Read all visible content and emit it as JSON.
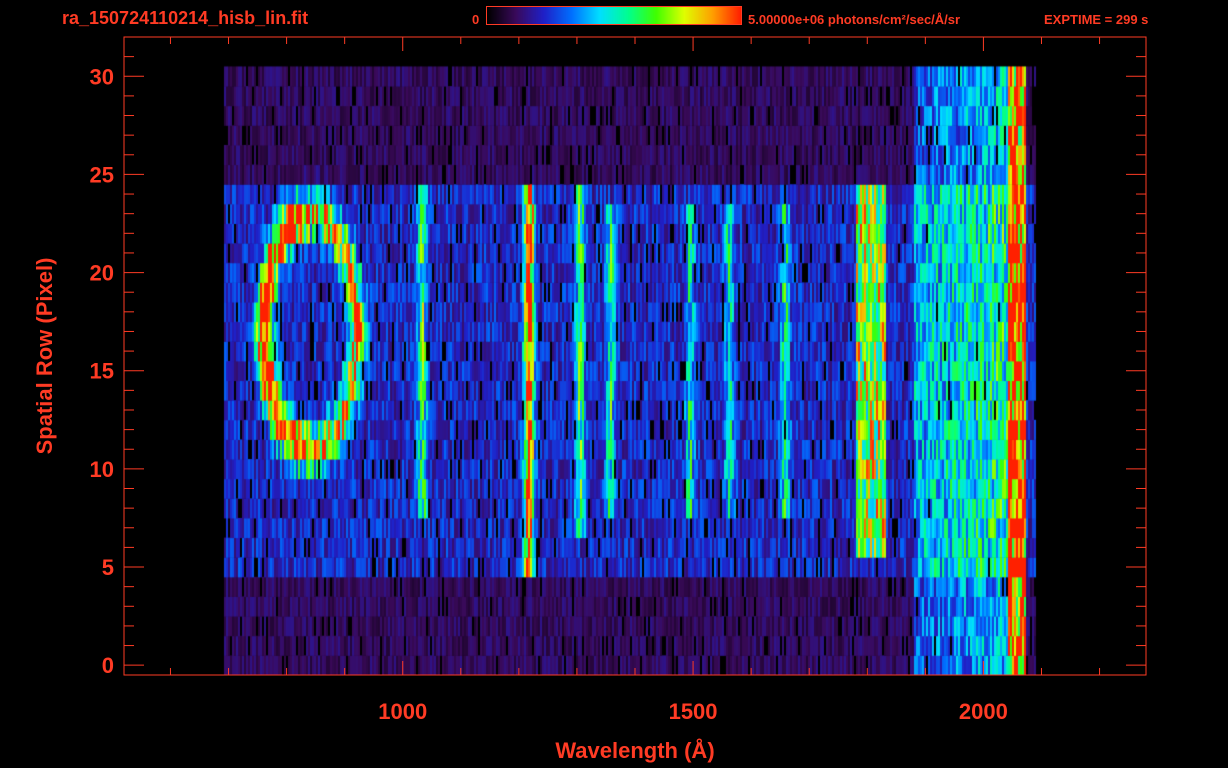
{
  "header": {
    "file_title": "ra_150724110214_hisb_lin.fit",
    "colorbar_min": "0",
    "colorbar_max": "5.00000e+06 photons/cm²/sec/Å/sr",
    "exptime": "EXPTIME = 299 s"
  },
  "colors": {
    "axis": "#ff3b24",
    "background": "#000000",
    "colormap": [
      "#000000",
      "#3a0a5a",
      "#2020c8",
      "#0070ff",
      "#00e0ff",
      "#00ff90",
      "#40ff00",
      "#e0ff00",
      "#ffa000",
      "#ff2000"
    ]
  },
  "chart_data": {
    "type": "heatmap",
    "xlabel": "Wavelength (Å)",
    "ylabel": "Spatial Row (Pixel)",
    "xlim": [
      520,
      2280
    ],
    "ylim": [
      -0.5,
      32
    ],
    "x_ticks": [
      1000,
      1500,
      2000
    ],
    "y_ticks": [
      0,
      5,
      10,
      15,
      20,
      25,
      30
    ],
    "color_range": [
      0,
      5000000
    ],
    "color_units": "photons/cm²/sec/Å/sr",
    "data_extent": {
      "x": [
        690,
        2090
      ],
      "y": [
        0,
        30
      ]
    },
    "features": [
      {
        "name": "ring",
        "x": 840,
        "y": 17,
        "rx": 80,
        "ry": 6,
        "peak": 0.85
      },
      {
        "name": "line-1030",
        "x": 1032,
        "y_range": [
          8,
          24
        ],
        "peak": 0.4
      },
      {
        "name": "line-1216",
        "x": 1216,
        "y_range": [
          5,
          24
        ],
        "peak": 1.0
      },
      {
        "name": "line-1304",
        "x": 1304,
        "y_range": [
          7,
          24
        ],
        "peak": 0.38
      },
      {
        "name": "line-1356",
        "x": 1356,
        "y_range": [
          8,
          23
        ],
        "peak": 0.33
      },
      {
        "name": "line-1493",
        "x": 1493,
        "y_range": [
          8,
          23
        ],
        "peak": 0.3
      },
      {
        "name": "line-1561",
        "x": 1561,
        "y_range": [
          8,
          23
        ],
        "peak": 0.3
      },
      {
        "name": "line-1657",
        "x": 1657,
        "y_range": [
          8,
          23
        ],
        "peak": 0.3
      },
      {
        "name": "continuum-1800",
        "x_range": [
          1780,
          1830
        ],
        "y_range": [
          6,
          24
        ],
        "peak": 0.5
      },
      {
        "name": "edge-2060",
        "x_range": [
          2040,
          2070
        ],
        "y_range": [
          0,
          30
        ],
        "peak": 0.85
      }
    ]
  }
}
